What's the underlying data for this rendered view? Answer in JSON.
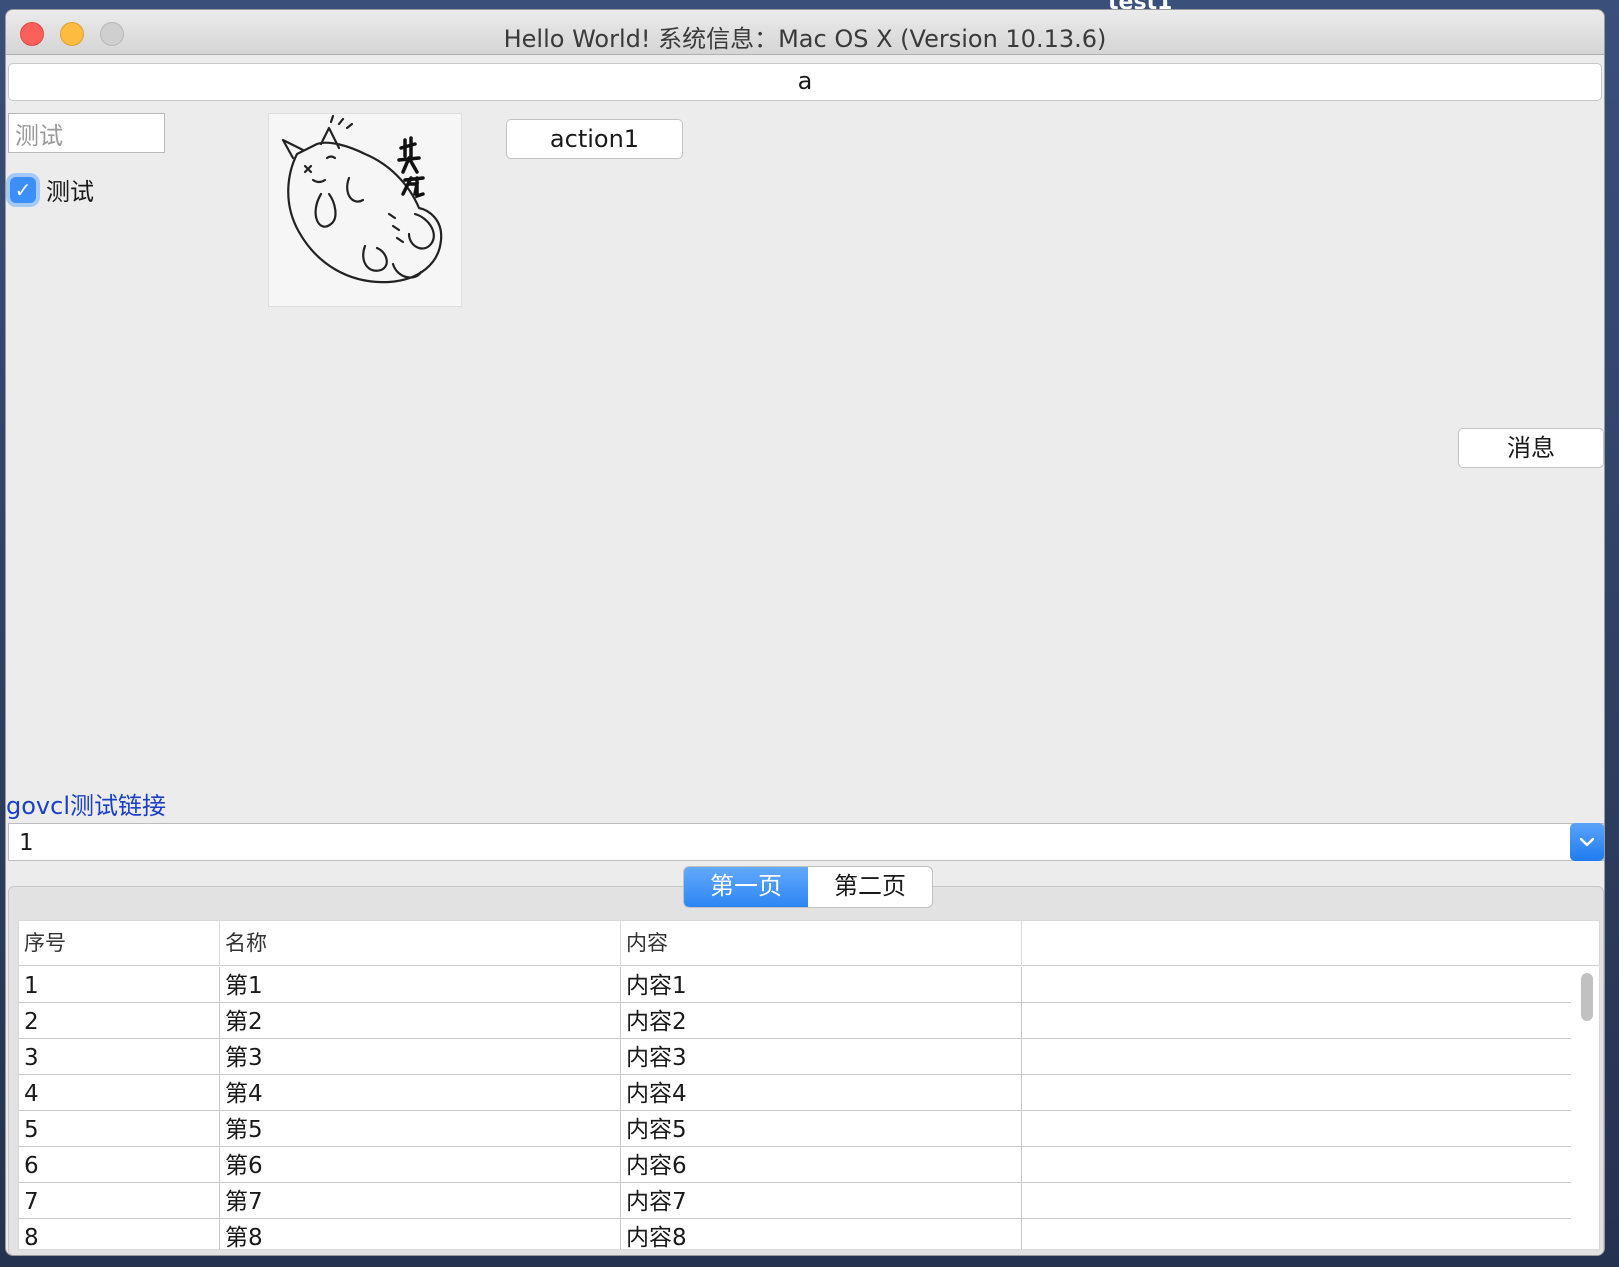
{
  "desktop": {
    "label": "test1"
  },
  "window": {
    "title": "Hello World! 系统信息：Mac OS X (Version 10.13.6)"
  },
  "top_button": {
    "label": "a"
  },
  "edit": {
    "value": "测试"
  },
  "checkbox": {
    "label": "测试",
    "checked": true
  },
  "action_button": {
    "label": "action1"
  },
  "message_button": {
    "label": "消息"
  },
  "link": {
    "label": "govcl测试链接"
  },
  "combo": {
    "value": "1"
  },
  "tabs": [
    {
      "label": "第一页",
      "active": true
    },
    {
      "label": "第二页",
      "active": false
    }
  ],
  "grid": {
    "columns": [
      "序号",
      "名称",
      "内容",
      ""
    ],
    "rows": [
      [
        "1",
        "第1",
        "内容1",
        ""
      ],
      [
        "2",
        "第2",
        "内容2",
        ""
      ],
      [
        "3",
        "第3",
        "内容3",
        ""
      ],
      [
        "4",
        "第4",
        "内容4",
        ""
      ],
      [
        "5",
        "第5",
        "内容5",
        ""
      ],
      [
        "6",
        "第6",
        "内容6",
        ""
      ],
      [
        "7",
        "第7",
        "内容7",
        ""
      ],
      [
        "8",
        "第8",
        "内容8",
        ""
      ]
    ]
  },
  "colors": {
    "accent": "#3b8ff6",
    "link": "#1c3fc7",
    "close": "#fc605b",
    "minimize": "#fdbc40",
    "zoom_disabled": "#cfcfcf"
  }
}
